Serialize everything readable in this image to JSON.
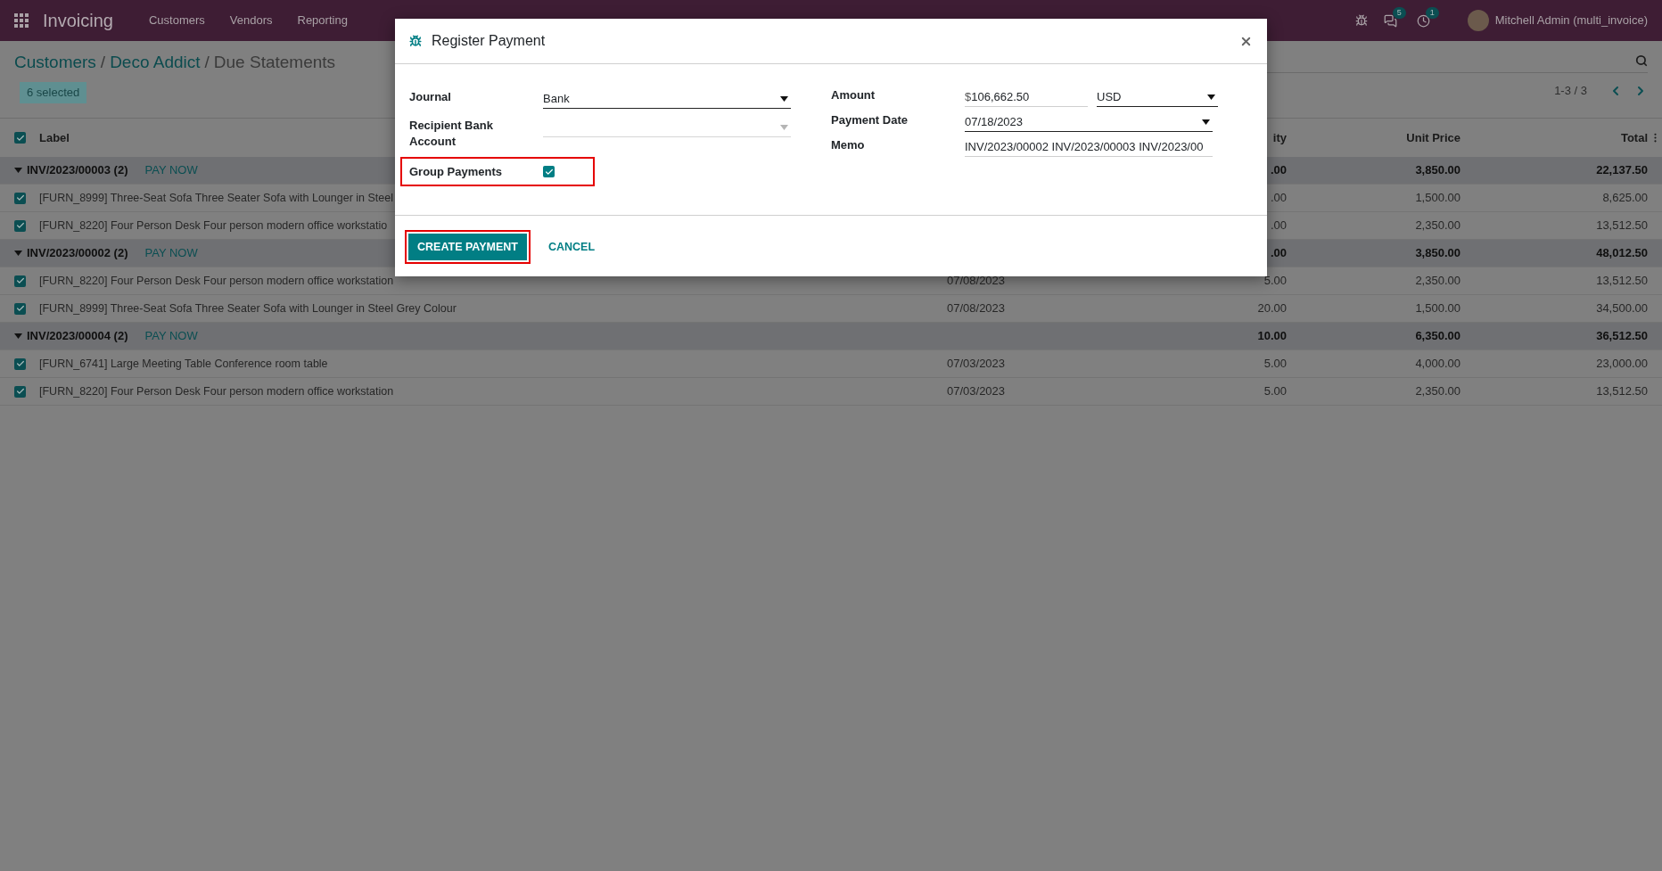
{
  "navbar": {
    "app_name": "Invoicing",
    "menu": [
      "Customers",
      "Vendors",
      "Reporting"
    ],
    "messages_badge": "5",
    "activities_badge": "1",
    "user": "Mitchell Admin (multi_invoice)"
  },
  "breadcrumb": [
    {
      "label": "Customers",
      "kind": "link"
    },
    {
      "label": "/",
      "kind": "separator"
    },
    {
      "label": "Deco Addict",
      "kind": "link"
    },
    {
      "label": "/",
      "kind": "separator"
    },
    {
      "label": "Due Statements",
      "kind": "current"
    }
  ],
  "selection_badge": "6 selected",
  "pager": "1-3 / 3",
  "table": {
    "all_checked": true,
    "columns": [
      "Label",
      "ity",
      "Unit Price",
      "Total"
    ],
    "groups": [
      {
        "title": "INV/2023/00003 (2)",
        "action": "PAY NOW",
        "expanded": true,
        "quantity": ".00",
        "unit_price": "3,850.00",
        "total": "22,137.50",
        "rows": [
          {
            "checked": true,
            "label": "[FURN_8999] Three-Seat Sofa Three Seater Sofa with Lounger in Steel",
            "quantity": ".00",
            "unit_price": "1,500.00",
            "total": "8,625.00"
          },
          {
            "checked": true,
            "label": "[FURN_8220] Four Person Desk Four person modern office workstatio",
            "quantity": ".00",
            "unit_price": "2,350.00",
            "total": "13,512.50"
          }
        ]
      },
      {
        "title": "INV/2023/00002 (2)",
        "action": "PAY NOW",
        "expanded": true,
        "quantity": ".00",
        "unit_price": "3,850.00",
        "total": "48,012.50",
        "rows": [
          {
            "checked": true,
            "label": "[FURN_8220] Four Person Desk Four person modern office workstation",
            "date": "07/08/2023",
            "quantity": "5.00",
            "unit_price": "2,350.00",
            "total": "13,512.50"
          },
          {
            "checked": true,
            "label": "[FURN_8999] Three-Seat Sofa Three Seater Sofa with Lounger in Steel Grey Colour",
            "date": "07/08/2023",
            "quantity": "20.00",
            "unit_price": "1,500.00",
            "total": "34,500.00"
          }
        ]
      },
      {
        "title": "INV/2023/00004 (2)",
        "action": "PAY NOW",
        "expanded": true,
        "quantity": "10.00",
        "unit_price": "6,350.00",
        "total": "36,512.50",
        "rows": [
          {
            "checked": true,
            "label": "[FURN_6741] Large Meeting Table Conference room table",
            "date": "07/03/2023",
            "quantity": "5.00",
            "unit_price": "4,000.00",
            "total": "23,000.00"
          },
          {
            "checked": true,
            "label": "[FURN_8220] Four Person Desk Four person modern office workstation",
            "date": "07/03/2023",
            "quantity": "5.00",
            "unit_price": "2,350.00",
            "total": "13,512.50"
          }
        ]
      }
    ]
  },
  "modal": {
    "title": "Register Payment",
    "fields_left": [
      {
        "label": "Journal",
        "kind": "select",
        "value": "Bank",
        "disabled": false,
        "highlighted": false
      },
      {
        "label": "Recipient Bank Account",
        "kind": "select",
        "disabled": true,
        "highlighted": false
      },
      {
        "label": "Group Payments",
        "kind": "checkbox",
        "checked": true,
        "highlighted": true
      }
    ],
    "fields_right": [
      {
        "label": "Amount",
        "kind": "amount",
        "currency_symbol": "$",
        "value": "106,662.50",
        "currency": "USD"
      },
      {
        "label": "Payment Date",
        "kind": "select",
        "value": "07/18/2023",
        "disabled": false
      },
      {
        "label": "Memo",
        "kind": "text",
        "value": "INV/2023/00002 INV/2023/00003 INV/2023/00"
      }
    ],
    "buttons": [
      {
        "label": "CREATE PAYMENT",
        "kind": "primary",
        "highlighted": true
      },
      {
        "label": "CANCEL",
        "kind": "link",
        "highlighted": false
      }
    ]
  }
}
